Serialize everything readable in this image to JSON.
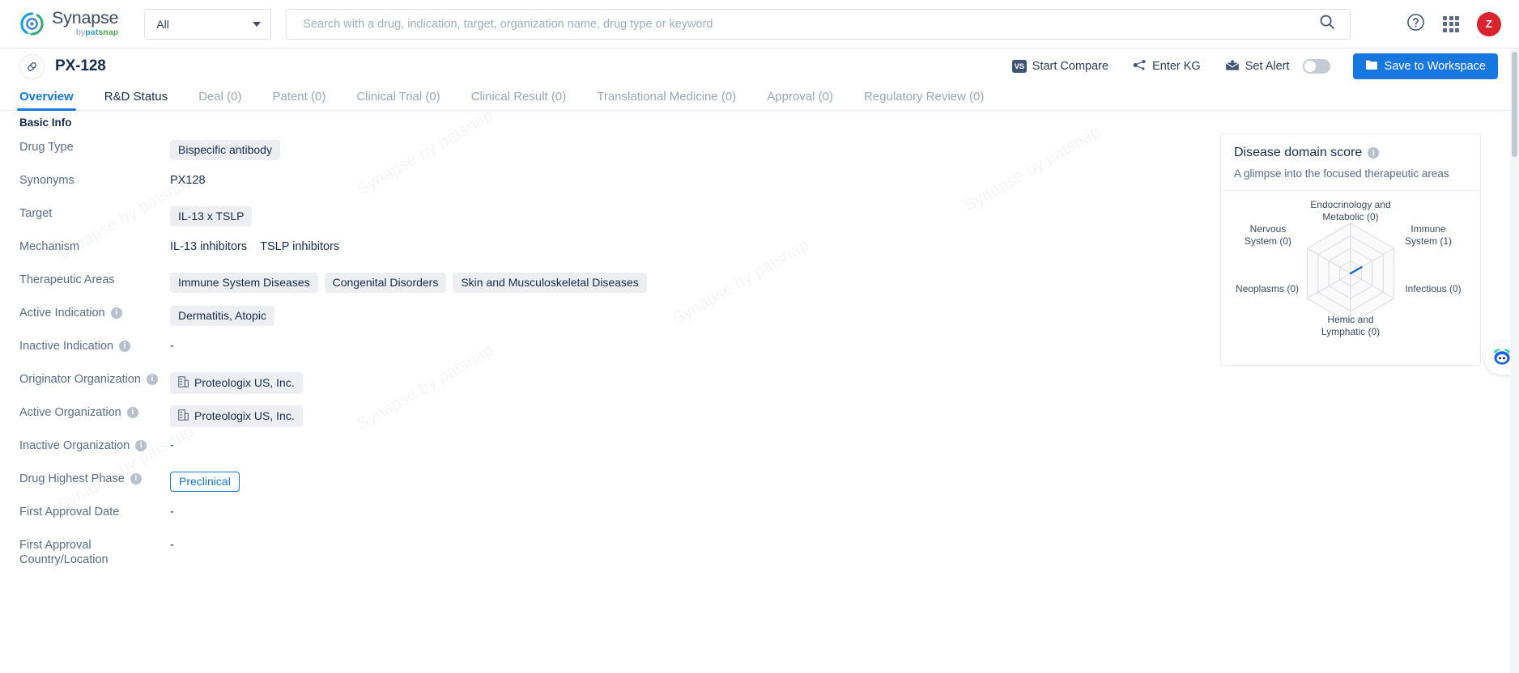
{
  "header": {
    "brand": {
      "name": "Synapse",
      "by": "by",
      "pat": "pat",
      "snap": "snap",
      "logo_icon": "synapse-logo-icon"
    },
    "scope": {
      "value": "All",
      "caret_icon": "chevron-down-icon"
    },
    "search": {
      "value": "",
      "placeholder": "Search with a drug, indication, target, organization name, drug type or keyword",
      "icon": "search-icon"
    },
    "help_icon": "help-circle-icon",
    "apps_icon": "apps-grid-icon",
    "avatar": {
      "initial": "Z",
      "color": "#d9232e"
    }
  },
  "title_row": {
    "badge_icon": "pill-capsule-icon",
    "drug_name": "PX-128",
    "actions": [
      {
        "label": "Start Compare",
        "icon": "vs-compare-icon"
      },
      {
        "label": "Enter KG",
        "icon": "knowledge-graph-icon"
      },
      {
        "label": "Set Alert",
        "icon": "alert-bell-mail-icon"
      }
    ],
    "toggle_state": "off",
    "save_button": {
      "label": "Save to Workspace",
      "icon": "folder-icon",
      "color": "#1677e0"
    }
  },
  "tabs": [
    {
      "label": "Overview",
      "state": "active"
    },
    {
      "label": "R&D Status",
      "state": "enabled"
    },
    {
      "label": "Deal (0)",
      "state": "disabled"
    },
    {
      "label": "Patent (0)",
      "state": "disabled"
    },
    {
      "label": "Clinical Trial (0)",
      "state": "disabled"
    },
    {
      "label": "Clinical Result (0)",
      "state": "disabled"
    },
    {
      "label": "Translational Medicine (0)",
      "state": "disabled"
    },
    {
      "label": "Approval (0)",
      "state": "disabled"
    },
    {
      "label": "Regulatory Review (0)",
      "state": "disabled"
    }
  ],
  "basic_info": {
    "section_title": "Basic Info",
    "rows": [
      {
        "label": "Drug Type",
        "info": false,
        "type": "chips",
        "values": [
          "Bispecific antibody"
        ]
      },
      {
        "label": "Synonyms",
        "info": false,
        "type": "text",
        "values": [
          "PX128"
        ]
      },
      {
        "label": "Target",
        "info": false,
        "type": "chips",
        "values": [
          "IL-13 x TSLP"
        ]
      },
      {
        "label": "Mechanism",
        "info": false,
        "type": "mech",
        "values": [
          "IL-13 inhibitors",
          "TSLP inhibitors"
        ]
      },
      {
        "label": "Therapeutic Areas",
        "info": false,
        "type": "chips",
        "values": [
          "Immune System Diseases",
          "Congenital Disorders",
          "Skin and Musculoskeletal Diseases"
        ]
      },
      {
        "label": "Active Indication",
        "info": true,
        "type": "chips",
        "values": [
          "Dermatitis, Atopic"
        ]
      },
      {
        "label": "Inactive Indication",
        "info": true,
        "type": "dash",
        "values": [
          "-"
        ]
      },
      {
        "label": "Originator Organization",
        "info": true,
        "type": "org",
        "values": [
          "Proteologix US, Inc."
        ]
      },
      {
        "label": "Active Organization",
        "info": true,
        "type": "org",
        "values": [
          "Proteologix US, Inc."
        ]
      },
      {
        "label": "Inactive Organization",
        "info": true,
        "type": "dash",
        "values": [
          "-"
        ]
      },
      {
        "label": "Drug Highest Phase",
        "info": true,
        "type": "phase",
        "values": [
          "Preclinical"
        ]
      },
      {
        "label": "First Approval Date",
        "info": false,
        "type": "dash",
        "values": [
          "-"
        ]
      },
      {
        "label": "First Approval Country/Location",
        "info": false,
        "type": "dash",
        "values": [
          "-"
        ]
      }
    ]
  },
  "side_card": {
    "title": "Disease domain score",
    "info_icon": "info-icon",
    "subtitle": "A glimpse into the focused therapeutic areas"
  },
  "chart_data": {
    "type": "radar",
    "title": "Disease domain score",
    "grid": true,
    "rings": 4,
    "rlim": [
      0,
      4
    ],
    "legend": "none",
    "line_color": "#1463c6",
    "grid_color": "#d6d9de",
    "categories": [
      "Endocrinology and Metabolic (0)",
      "Immune System (1)",
      "Infectious (0)",
      "Hemic and Lymphatic (0)",
      "Neoplasms (0)",
      "Nervous System (0)"
    ],
    "labels_multiline": [
      "Endocrinology and\nMetabolic (0)",
      "Immune\nSystem (1)",
      "Infectious (0)",
      "Hemic and\nLymphatic (0)",
      "Neoplasms (0)",
      "Nervous\nSystem (0)"
    ],
    "values": [
      0,
      1,
      0,
      0,
      0,
      0
    ]
  },
  "floating": {
    "bot_icon": "chat-bot-icon"
  },
  "watermark_text": "Synapse by patsnap"
}
